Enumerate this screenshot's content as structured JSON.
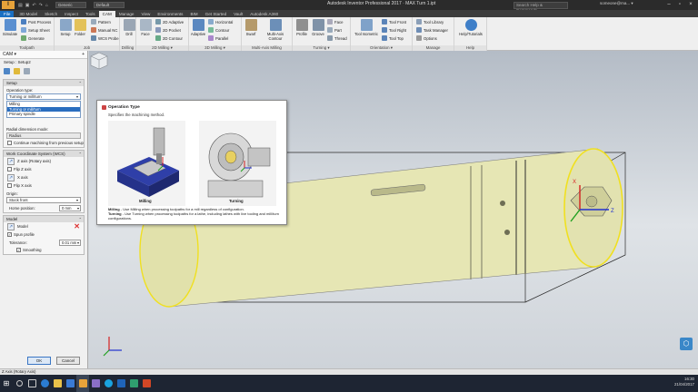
{
  "app": {
    "title": "Autodesk Inventor Professional 2017 · MAX Turn 1.ipt",
    "logo": "I",
    "home_combo": "Generic",
    "material_combo": "Default",
    "search_placeholder": "Search Help & Commands...",
    "user": "someone@ma... ▾"
  },
  "qat_icons": [
    "folder-icon",
    "save-icon",
    "undo-icon",
    "redo-icon",
    "home-icon"
  ],
  "tabs": [
    "File",
    "3D Model",
    "Sketch",
    "Inspect",
    "Tools",
    "CAM",
    "Manage",
    "View",
    "Environments",
    "BIM",
    "Get Started",
    "Vault",
    "Autodesk A360"
  ],
  "ribbon": {
    "groups": {
      "toolpath": "Toolpath",
      "job": "Job",
      "drilling": "Drilling",
      "milling2d": "2D Milling ▾",
      "milling3d": "3D Milling ▾",
      "multiaxis": "Multi-Axis Milling",
      "turning": "Turning ▾",
      "orientation": "Orientation ▾",
      "manage": "Manage",
      "help": "Help"
    },
    "buttons": {
      "simulate": "Simulate",
      "post_process": "Post Process",
      "setup_sheet": "Setup Sheet",
      "generate": "Generate",
      "setup": "Setup",
      "folder": "Folder",
      "pattern": "Pattern",
      "manual_nc": "Manual NC",
      "wcs_probe": "WCS Probe",
      "drill": "Drill",
      "face": "Face",
      "pocket2d": "2D Pocket",
      "adaptive2d": "2D Adaptive",
      "contour2d": "2D Contour",
      "adaptive": "Adaptive",
      "horizontal": "Horizontal",
      "contour": "Contour",
      "parallel": "Parallel",
      "swarf": "Swarf",
      "multi_axis_contour": "Multi-Axis Contour",
      "profile": "Profile",
      "groove": "Groove",
      "face_t": "Face",
      "part": "Part",
      "thread": "Thread",
      "tool_isometric": "Tool Isometric",
      "tool_front": "Tool Front",
      "tool_right": "Tool Right",
      "tool_top": "Tool Top",
      "tool_library": "Tool Library",
      "task_manager": "Task Manager",
      "options": "Options",
      "help_tutorials": "Help/Tutorials"
    }
  },
  "left_panel": {
    "header": "CAM ▾",
    "setup_row": "Setup : Setup2",
    "setup_section": "Setup",
    "operation_type_label": "Operation type:",
    "operation_type_value": "Turning or mill/turn",
    "operation_options": [
      "Milling",
      "Turning or mill/turn",
      "Primary spindle"
    ],
    "radial_label": "Radial dimension mode:",
    "radial_value": "Radius",
    "continue_label": "Continue machining from previous setup",
    "wcs_section": "Work Coordinate System (WCS)",
    "z_axis_label": "Z axis (Rotary axis)",
    "flip_z": "Flip Z axis",
    "x_axis_label": "X axis",
    "flip_x": "Flip X axis",
    "origin_label": "Origin:",
    "origin_value": "Stock front",
    "home_position_label": "Home position:",
    "home_position_value": "0 mm",
    "model_section": "Model",
    "model_label": "Model",
    "spun_profile": "Spun profile",
    "tolerance_label": "Tolerance:",
    "tolerance_value": "0.01 mm",
    "smoothing": "Smoothing",
    "ok": "OK",
    "cancel": "Cancel"
  },
  "tooltip": {
    "title": "Operation Type",
    "subtitle": "Specifies the machining method.",
    "caption_milling": "Milling",
    "caption_turning": "Turning",
    "desc_milling_bold": "Milling",
    "desc_milling": " - Use Milling when processing toolpaths for a mill regardless of configuration.",
    "desc_turning_bold": "Turning",
    "desc_turning": " - Use Turning when processing toolpaths for a lathe, including lathes with live tooling and mill/turn configurations."
  },
  "viewport": {
    "axis_labels": {
      "x": "X",
      "z": "Z"
    }
  },
  "status": "Z Axis (Rotary Axis)",
  "taskbar": {
    "time": "16:30",
    "date": "21/04/2017",
    "icons": [
      "start-icon",
      "search-icon",
      "taskview-icon",
      "edge-icon",
      "explorer-icon",
      "store-icon",
      "inventor-icon",
      "app-icon",
      "skype-icon",
      "outlook-icon",
      "vpn-icon",
      "powerpoint-icon"
    ]
  },
  "colors": {
    "file_tab": "#1a6fc2",
    "cylinder": "#e6e6b4",
    "highlight_yellow": "#f0e020",
    "selection_blue": "#2a6ebf"
  }
}
